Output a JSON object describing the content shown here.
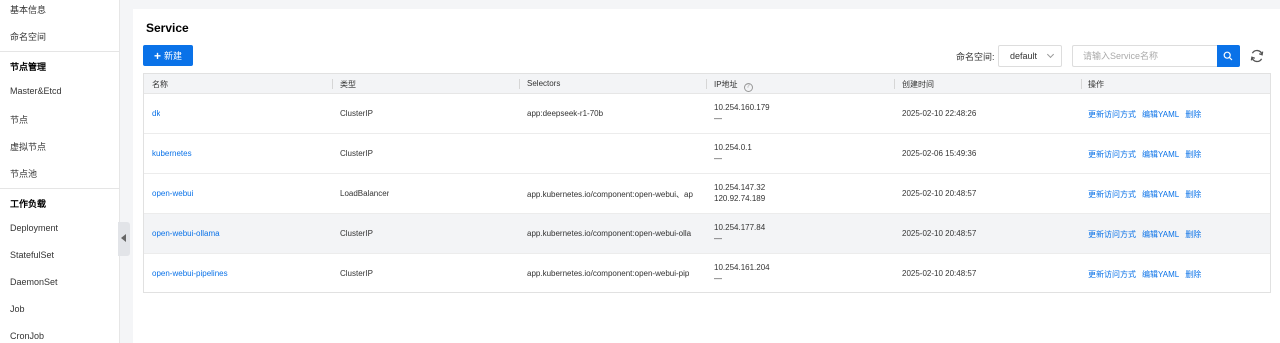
{
  "sidebar": {
    "items": [
      {
        "label": "基本信息",
        "type": "item"
      },
      {
        "label": "命名空间",
        "type": "item"
      },
      {
        "label": "节点管理",
        "type": "group"
      },
      {
        "label": "Master&Etcd",
        "type": "item"
      },
      {
        "label": "节点",
        "type": "item"
      },
      {
        "label": "虚拟节点",
        "type": "item"
      },
      {
        "label": "节点池",
        "type": "item"
      },
      {
        "label": "工作负载",
        "type": "group"
      },
      {
        "label": "Deployment",
        "type": "item"
      },
      {
        "label": "StatefulSet",
        "type": "item"
      },
      {
        "label": "DaemonSet",
        "type": "item"
      },
      {
        "label": "Job",
        "type": "item"
      },
      {
        "label": "CronJob",
        "type": "item"
      }
    ]
  },
  "header": {
    "title": "Service",
    "new_button": "新建",
    "namespace_label": "命名空间:",
    "namespace_value": "default",
    "search_placeholder": "请输入Service名称"
  },
  "table": {
    "columns": [
      "名称",
      "类型",
      "Selectors",
      "IP地址",
      "创建时间",
      "操作"
    ],
    "rows": [
      {
        "name": "dk",
        "type": "ClusterIP",
        "selectors": "app:deepseek-r1-70b",
        "ip1": "10.254.160.179",
        "ip2": "—",
        "created": "2025-02-10 22:48:26"
      },
      {
        "name": "kubernetes",
        "type": "ClusterIP",
        "selectors": "",
        "ip1": "10.254.0.1",
        "ip2": "—",
        "created": "2025-02-06 15:49:36"
      },
      {
        "name": "open-webui",
        "type": "LoadBalancer",
        "selectors": "app.kubernetes.io/component:open-webui、ap",
        "ip1": "10.254.147.32",
        "ip2": "120.92.74.189",
        "created": "2025-02-10 20:48:57"
      },
      {
        "name": "open-webui-ollama",
        "type": "ClusterIP",
        "selectors": "app.kubernetes.io/component:open-webui-olla",
        "ip1": "10.254.177.84",
        "ip2": "—",
        "created": "2025-02-10 20:48:57"
      },
      {
        "name": "open-webui-pipelines",
        "type": "ClusterIP",
        "selectors": "app.kubernetes.io/component:open-webui-pip",
        "ip1": "10.254.161.204",
        "ip2": "—",
        "created": "2025-02-10 20:48:57"
      }
    ],
    "actions": {
      "update": "更新访问方式",
      "edit": "编辑YAML",
      "delete": "删除"
    }
  },
  "colors": {
    "accent": "#0a72e8",
    "row_highlight": "#f3f4f6"
  }
}
